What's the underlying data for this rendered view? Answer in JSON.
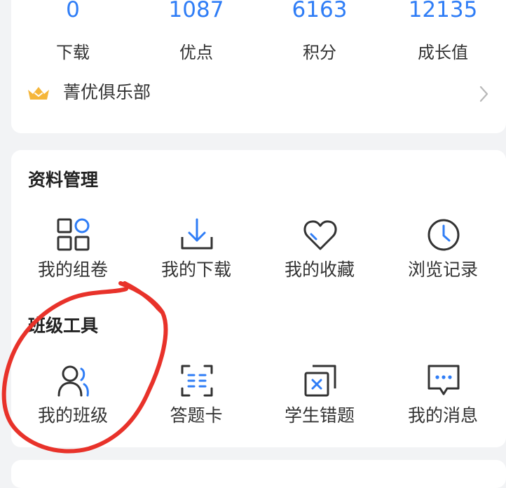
{
  "stats": [
    {
      "value": "0",
      "label": "下载"
    },
    {
      "value": "1087",
      "label": "优点"
    },
    {
      "value": "6163",
      "label": "积分"
    },
    {
      "value": "12135",
      "label": "成长值"
    }
  ],
  "club": {
    "label": "菁优俱乐部",
    "icon": "crown-icon",
    "chevron": "chevron-right-icon"
  },
  "materials": {
    "title": "资料管理",
    "items": [
      {
        "label": "我的组卷",
        "icon": "grid-apps-icon"
      },
      {
        "label": "我的下载",
        "icon": "download-icon"
      },
      {
        "label": "我的收藏",
        "icon": "heart-icon"
      },
      {
        "label": "浏览记录",
        "icon": "clock-icon"
      }
    ]
  },
  "class_tools": {
    "title": "班级工具",
    "items": [
      {
        "label": "我的班级",
        "icon": "users-icon"
      },
      {
        "label": "答题卡",
        "icon": "answer-card-icon"
      },
      {
        "label": "学生错题",
        "icon": "wrong-questions-icon"
      },
      {
        "label": "我的消息",
        "icon": "message-icon"
      }
    ]
  },
  "colors": {
    "accent": "#2f7df6",
    "icon_dark": "#333333",
    "annotation": "#e8322a",
    "crown": "#f5b63a"
  }
}
